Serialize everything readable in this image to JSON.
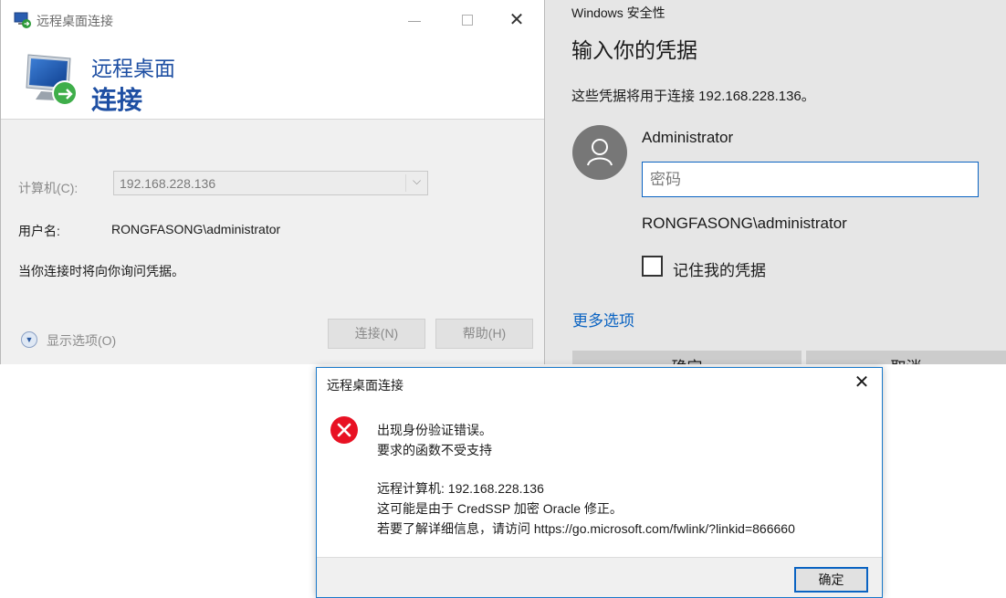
{
  "rdc": {
    "window_title": "远程桌面连接",
    "window_controls": {
      "minimize": "—",
      "close": "✕"
    },
    "banner_line1": "远程桌面",
    "banner_line2": "连接",
    "computer_label": "计算机(C):",
    "computer_value": "192.168.228.136",
    "username_label": "用户名:",
    "username_value": "RONGFASONG\\administrator",
    "prompt_text": "当你连接时将向你询问凭据。",
    "show_options": "显示选项(O)",
    "connect_button": "连接(N)",
    "help_button": "帮助(H)"
  },
  "security": {
    "header": "Windows 安全性",
    "title": "输入你的凭据",
    "description": "这些凭据将用于连接 192.168.228.136。",
    "username": "Administrator",
    "password_placeholder": "密码",
    "domain_user": "RONGFASONG\\administrator",
    "remember_label": "记住我的凭据",
    "remember_checked": false,
    "more_options": "更多选项",
    "ok_button": "确定",
    "cancel_button": "取消"
  },
  "error_dialog": {
    "title": "远程桌面连接",
    "close": "✕",
    "line1": "出现身份验证错误。",
    "line2": "要求的函数不受支持",
    "line3": "远程计算机: 192.168.228.136",
    "line4": "这可能是由于 CredSSP 加密 Oracle 修正。",
    "line5": "若要了解详细信息，请访问 https://go.microsoft.com/fwlink/?linkid=866660",
    "ok_button": "确定"
  },
  "icons": {
    "rdc_app": "remote-desktop-icon",
    "error": "error-icon",
    "user": "user-avatar-icon",
    "expand": "chevron-down-icon"
  },
  "colors": {
    "accent_blue": "#0a63c2",
    "banner_blue": "#1e4fa3",
    "error_red": "#e81123"
  }
}
